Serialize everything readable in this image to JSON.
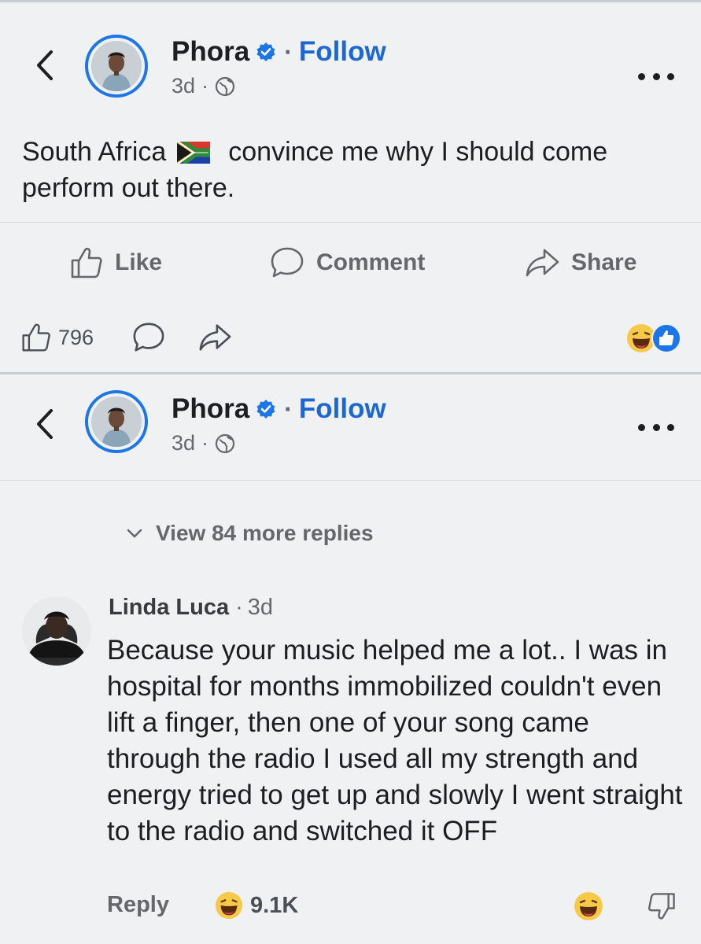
{
  "post1": {
    "author": "Phora",
    "follow_label": "Follow",
    "separator": "·",
    "age": "3d",
    "text_before_flag": "South Africa",
    "text_after_flag": "convince me why I should come perform out there.",
    "actions": {
      "like_label": "Like",
      "comment_label": "Comment",
      "share_label": "Share"
    },
    "like_count": "796"
  },
  "post2": {
    "author": "Phora",
    "follow_label": "Follow",
    "separator": "·",
    "age": "3d",
    "view_replies_label": "View 84 more replies"
  },
  "comment": {
    "author": "Linda Luca",
    "separator": "·",
    "age": "3d",
    "text": "Because your music helped me a lot.. I was in hospital for months immobilized couldn't even lift a finger, then one of your song came through the radio I used all my strength and energy tried to get up and slowly I went straight to the radio and switched it OFF",
    "reply_label": "Reply",
    "reaction_count": "9.1K"
  },
  "colors": {
    "accent": "#1d67d2",
    "verified": "#1d76e8",
    "background": "#f0f1f3",
    "muted_text": "#65676b"
  }
}
